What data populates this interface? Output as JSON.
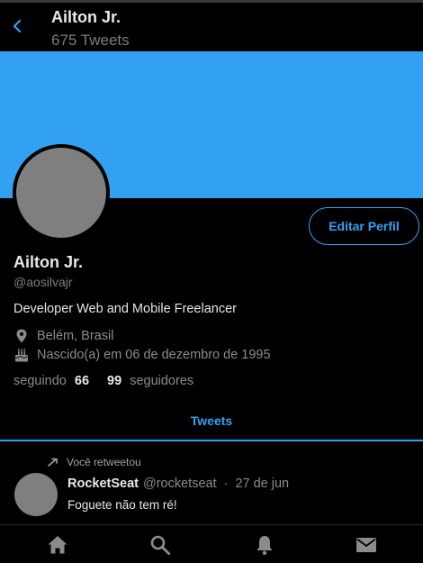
{
  "header": {
    "back_icon": "chevron-left-icon",
    "name": "Ailton Jr.",
    "tweet_count": "675 Tweets"
  },
  "colors": {
    "accent": "#33a1f2",
    "banner": "#33a1f2",
    "avatar_placeholder": "#7f7f7f",
    "background": "#000000"
  },
  "profile": {
    "edit_button": "Editar Perfil",
    "name": "Ailton Jr.",
    "handle": "@aosilvajr",
    "bio": "Developer Web and Mobile Freelancer",
    "location_icon": "location-pin-icon",
    "location": "Belém, Brasil",
    "birth_icon": "cake-icon",
    "birth": "Nascido(a) em 06 de dezembro de 1995",
    "following_label": "seguindo",
    "following_count": "66",
    "followers_count": "99",
    "followers_label": "seguidores"
  },
  "tabs": {
    "active": "Tweets"
  },
  "tweet": {
    "retweet_icon": "retweet-icon",
    "retweet_note": "Você retweetou",
    "author_name": "RocketSeat",
    "author_handle": "@rocketseat",
    "separator": "·",
    "date": "27 de jun",
    "text": "Foguete não tem ré!"
  },
  "bottom_nav": {
    "items": [
      "home-icon",
      "search-icon",
      "notifications-bell-icon",
      "messages-envelope-icon"
    ]
  }
}
